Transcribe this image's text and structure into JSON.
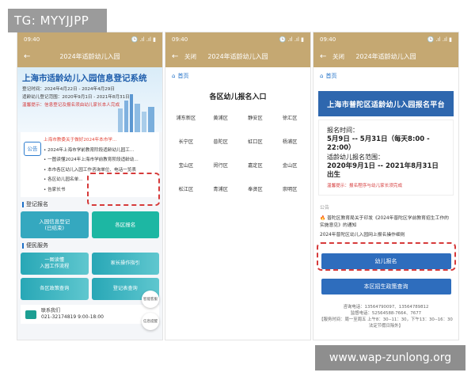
{
  "overlay": {
    "tg": "TG: MYYJJPP",
    "watermark": "www.wap-zunlong.org"
  },
  "status": {
    "time": "09:40",
    "signal": "🕒 .ıl .ıl ▮"
  },
  "phone1": {
    "nav_title": "2024年适龄幼儿入园",
    "banner_title": "上海市适龄幼儿入园信息登记系统",
    "banner_lines": [
      "登记时间：2024年4月22日 - 2024年4月29日",
      "适龄幼儿登记范围：2020年9月1日 - 2021年8月31日",
      "温馨提示：信息登记及报名须由幼儿家长本人完成"
    ],
    "notice_icon": "公告",
    "notices": [
      "上海市教委关于做好2024年本市学...",
      "• 2024年上海市学前教育阶段适龄幼儿园工...",
      "• 一图读懂2024年上海市学前教育阶段适龄幼...",
      "• 本市各区幼儿入园工作咨询单位、电话一览表",
      "• 各区幼儿园名单...",
      "• 告家长书"
    ],
    "section_register": "登记报名",
    "reg_a": "入园信息登记\n(已结束)",
    "reg_b": "各区报名",
    "section_service": "便民服务",
    "services": [
      "一图读懂\n入园工作流程",
      "家长操作指引",
      "各区政策查询",
      "登记表查询"
    ],
    "contact_label": "联系我们",
    "contact_value": "021-32174819 9:00-18:00",
    "float_a": "智能客服",
    "float_b": "信息提醒"
  },
  "phone2": {
    "nav_close": "关闭",
    "nav_title": "2024年适龄幼儿入园",
    "home": "首页",
    "title": "各区幼儿报名入口",
    "districts": [
      "浦东新区",
      "黄浦区",
      "静安区",
      "徐汇区",
      "长宁区",
      "普陀区",
      "虹口区",
      "杨浦区",
      "宝山区",
      "闵行区",
      "嘉定区",
      "金山区",
      "松江区",
      "青浦区",
      "奉贤区",
      "崇明区"
    ]
  },
  "phone3": {
    "nav_close": "关闭",
    "nav_title": "2024年适龄幼儿入园",
    "home": "首页",
    "banner": "上海市普陀区适龄幼儿入园报名平台",
    "time_label": "报名时间：",
    "time_value": "5月9日 -- 5月31日（每天8:00 - 22:00）",
    "range_label": "适龄幼儿报名范围：",
    "range_value": "2020年9月1日 -- 2021年8月31日出生",
    "tip": "温馨提示：报名程序与幼儿家长须完成",
    "announcement_label": "公告",
    "notice_a": "普陀区教育局关于印发《2024年普陀区学前教育招生工作的实施意见》的通知",
    "notice_b": "2024年普陀区幼儿入园网上报名操作细则",
    "btn_signup": "幼儿报名",
    "btn_policy": "本区招生政策查询",
    "footer": [
      "咨询电话：13564790097、13564789812",
      "监督电话：52564588-7664、7677",
      "【服务时间：周一至周五 上午8：30--11：30，下午13：30--16：30 法定节假日除外】"
    ]
  }
}
